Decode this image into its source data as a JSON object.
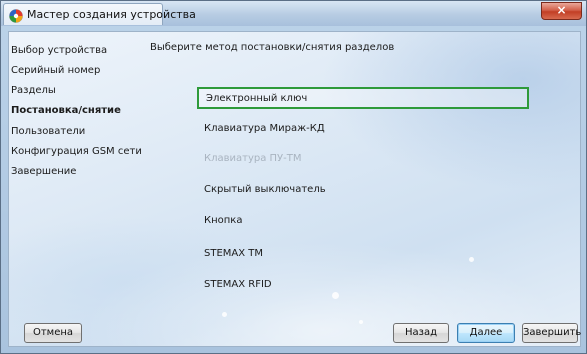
{
  "window": {
    "title": "Мастер создания устройства",
    "close_symbol": "×",
    "icon": "app-logo-icon"
  },
  "steps": [
    {
      "label": "Выбор устройства",
      "active": false
    },
    {
      "label": "Серийный номер",
      "active": false
    },
    {
      "label": "Разделы",
      "active": false
    },
    {
      "label": "Постановка/снятие",
      "active": true
    },
    {
      "label": "Пользователи",
      "active": false
    },
    {
      "label": "Конфигурация GSM сети",
      "active": false
    },
    {
      "label": "Завершение",
      "active": false
    }
  ],
  "main": {
    "heading": "Выберите метод постановки/снятия разделов",
    "options": [
      {
        "label": "Электронный ключ",
        "state": "selected"
      },
      {
        "label": "Клавиатура Мираж-КД",
        "state": "normal"
      },
      {
        "label": "Клавиатура ПУ-ТМ",
        "state": "disabled"
      },
      {
        "label": "Скрытый выключатель",
        "state": "normal"
      },
      {
        "label": "Кнопка",
        "state": "normal"
      },
      {
        "label": "STEMAX TM",
        "state": "normal"
      },
      {
        "label": "STEMAX RFID",
        "state": "normal"
      }
    ]
  },
  "buttons": {
    "cancel": "Отмена",
    "back": "Назад",
    "next": "Далее",
    "finish": "Завершить"
  },
  "colors": {
    "selection_border": "#2e9a3a",
    "close_button": "#c23f25",
    "default_button": "#3c7fb1"
  }
}
